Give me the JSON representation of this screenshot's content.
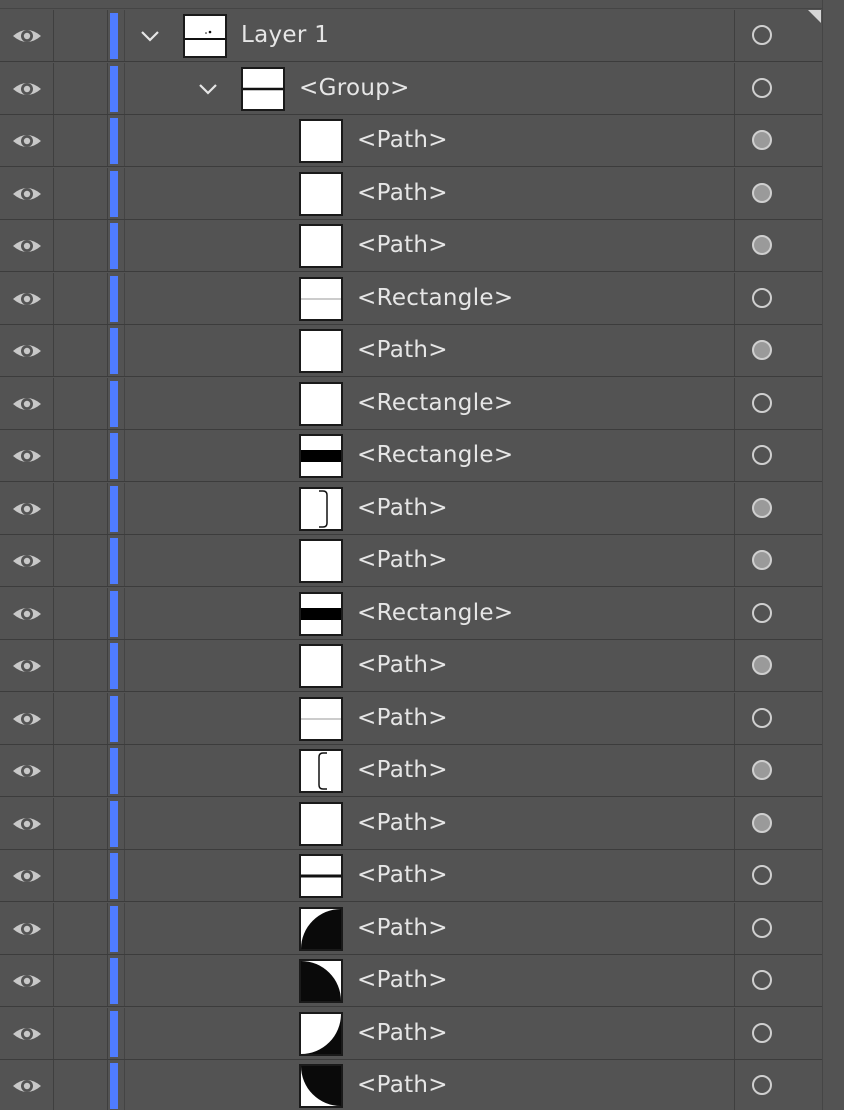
{
  "panel": {
    "colors": {
      "background": "#535353",
      "layer_color": "#4f7cff",
      "text": "#e6e6e6"
    },
    "rows": [
      {
        "label": "Layer 1",
        "level": 0,
        "expanded": true,
        "thumb": "layer",
        "target": "empty",
        "visibility_icon": "eye-icon"
      },
      {
        "label": "<Group>",
        "level": 1,
        "expanded": true,
        "thumb": "group",
        "target": "empty",
        "visibility_icon": "eye-icon"
      },
      {
        "label": "<Path>",
        "level": 2,
        "thumb": "blank",
        "target": "filled",
        "visibility_icon": "eye-icon"
      },
      {
        "label": "<Path>",
        "level": 2,
        "thumb": "blank",
        "target": "filled",
        "visibility_icon": "eye-icon"
      },
      {
        "label": "<Path>",
        "level": 2,
        "thumb": "blank",
        "target": "filled",
        "visibility_icon": "eye-icon"
      },
      {
        "label": "<Rectangle>",
        "level": 2,
        "thumb": "thin-line",
        "target": "empty",
        "visibility_icon": "eye-icon"
      },
      {
        "label": "<Path>",
        "level": 2,
        "thumb": "blank",
        "target": "filled",
        "visibility_icon": "eye-icon"
      },
      {
        "label": "<Rectangle>",
        "level": 2,
        "thumb": "blank",
        "target": "empty",
        "visibility_icon": "eye-icon"
      },
      {
        "label": "<Rectangle>",
        "level": 2,
        "thumb": "thick-bar",
        "target": "empty",
        "visibility_icon": "eye-icon"
      },
      {
        "label": "<Path>",
        "level": 2,
        "thumb": "bracket-right",
        "target": "filled",
        "visibility_icon": "eye-icon"
      },
      {
        "label": "<Path>",
        "level": 2,
        "thumb": "blank",
        "target": "filled",
        "visibility_icon": "eye-icon"
      },
      {
        "label": "<Rectangle>",
        "level": 2,
        "thumb": "thick-bar",
        "target": "empty",
        "visibility_icon": "eye-icon"
      },
      {
        "label": "<Path>",
        "level": 2,
        "thumb": "blank",
        "target": "filled",
        "visibility_icon": "eye-icon"
      },
      {
        "label": "<Path>",
        "level": 2,
        "thumb": "thin-line",
        "target": "empty",
        "visibility_icon": "eye-icon"
      },
      {
        "label": "<Path>",
        "level": 2,
        "thumb": "bracket-left",
        "target": "filled",
        "visibility_icon": "eye-icon"
      },
      {
        "label": "<Path>",
        "level": 2,
        "thumb": "blank",
        "target": "filled",
        "visibility_icon": "eye-icon"
      },
      {
        "label": "<Path>",
        "level": 2,
        "thumb": "medium-line",
        "target": "empty",
        "visibility_icon": "eye-icon"
      },
      {
        "label": "<Path>",
        "level": 2,
        "thumb": "quarter-bottom-left",
        "target": "empty",
        "visibility_icon": "eye-icon"
      },
      {
        "label": "<Path>",
        "level": 2,
        "thumb": "quarter-top-left",
        "target": "empty",
        "visibility_icon": "eye-icon"
      },
      {
        "label": "<Path>",
        "level": 2,
        "thumb": "quarter-bottom-right",
        "target": "empty",
        "visibility_icon": "eye-icon"
      },
      {
        "label": "<Path>",
        "level": 2,
        "thumb": "quarter-top-right",
        "target": "empty",
        "visibility_icon": "eye-icon"
      }
    ]
  }
}
